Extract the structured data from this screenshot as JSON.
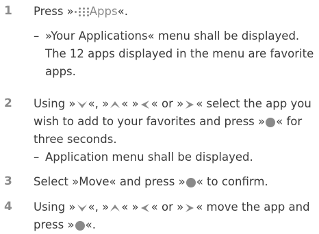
{
  "steps": [
    {
      "number": "1",
      "parts": {
        "a": "Press »",
        "apps": "Apps",
        "b": "«."
      },
      "note": "»Your Applications« menu shall be displayed. The 12 apps displayed in the menu are favorite apps."
    },
    {
      "number": "2",
      "parts": {
        "a": "Using »",
        "b": "«, »",
        "c": "« »",
        "d": "« or »",
        "e": "« select the app you wish to add to your favorites and press »",
        "f": "« for three seconds."
      },
      "note": "Application menu shall be displayed."
    },
    {
      "number": "3",
      "parts": {
        "a": "Select »Move« and press »",
        "b": "« to confirm."
      }
    },
    {
      "number": "4",
      "parts": {
        "a": "Using »",
        "b": "«, »",
        "c": "« »",
        "d": "« or »",
        "e": "« move the app and press »",
        "f": "«."
      }
    }
  ],
  "icons": {
    "apps": "grid-dots-icon",
    "down": "arrow-down-icon",
    "up": "arrow-up-icon",
    "left": "arrow-left-icon",
    "right": "arrow-right-icon",
    "ok": "ok-button-icon"
  },
  "colors": {
    "text": "#3b3b3b",
    "accent": "#8a8a8a"
  }
}
